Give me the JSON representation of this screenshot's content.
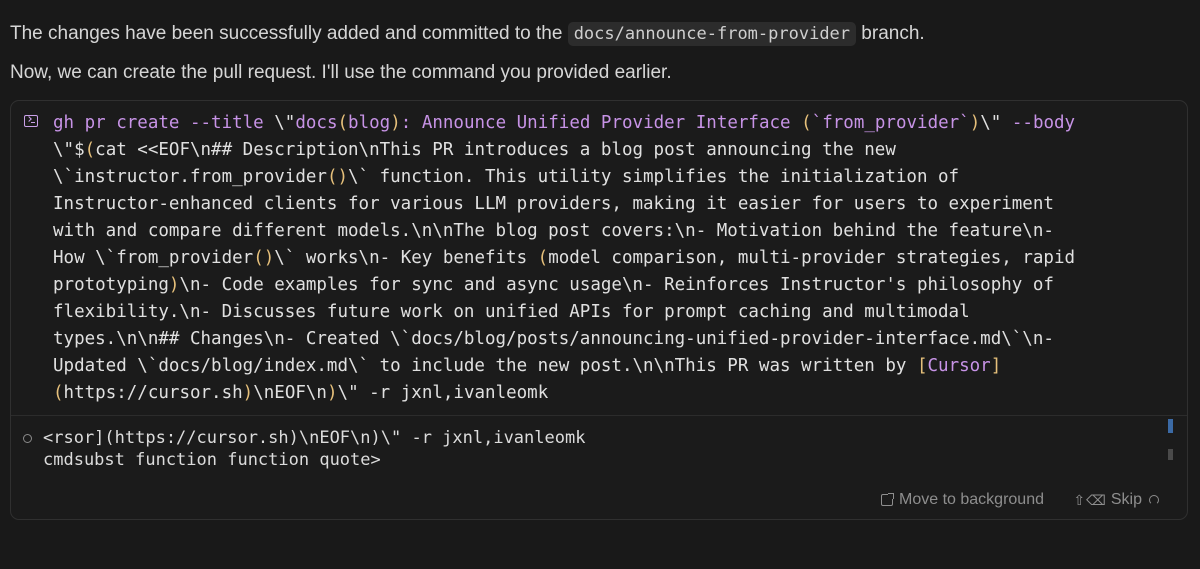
{
  "chat": {
    "line1_before": "The changes have been successfully added and committed to the ",
    "line1_code": "docs/announce-from-provider",
    "line1_after": " branch.",
    "line2": "Now, we can create the pull request. I'll use the command you provided earlier."
  },
  "command": {
    "lines": [
      [
        [
          "k",
          "gh pr create --title "
        ],
        [
          "o",
          "\\\""
        ],
        [
          "s",
          "docs"
        ],
        [
          "y",
          "("
        ],
        [
          "s",
          "blog"
        ],
        [
          "y",
          ")"
        ],
        [
          "s",
          ": Announce Unified Provider Interface "
        ],
        [
          "y",
          "("
        ],
        [
          "s",
          "`from_provider`"
        ],
        [
          "y",
          ")"
        ],
        [
          "o",
          "\\\""
        ],
        [
          "k",
          " --body"
        ]
      ],
      [
        [
          "o",
          "\\\"$"
        ],
        [
          "y",
          "("
        ],
        [
          "o",
          "cat <<EOF\\n## Description\\nThis PR introduces a blog post announcing the new"
        ]
      ],
      [
        [
          "o",
          "\\`instructor.from_provider"
        ],
        [
          "y",
          "()"
        ],
        [
          "o",
          "\\` function. This utility simplifies the initialization of"
        ]
      ],
      [
        [
          "o",
          "Instructor-enhanced clients for various LLM providers, making it easier for users to experiment"
        ]
      ],
      [
        [
          "o",
          "with and compare different models.\\n\\nThe blog post covers:\\n- Motivation behind the feature\\n-"
        ]
      ],
      [
        [
          "o",
          "How \\`from_provider"
        ],
        [
          "y",
          "()"
        ],
        [
          "o",
          "\\` works\\n- Key benefits "
        ],
        [
          "y",
          "("
        ],
        [
          "o",
          "model comparison, multi-provider strategies, rapid"
        ]
      ],
      [
        [
          "o",
          "prototyping"
        ],
        [
          "y",
          ")"
        ],
        [
          "o",
          "\\n- Code examples for sync and async usage\\n- Reinforces Instructor's philosophy of"
        ]
      ],
      [
        [
          "o",
          "flexibility.\\n- Discusses future work on unified APIs for prompt caching and multimodal"
        ]
      ],
      [
        [
          "o",
          "types.\\n\\n## Changes\\n- Created \\`docs/blog/posts/announcing-unified-provider-interface.md\\`\\n-"
        ]
      ],
      [
        [
          "o",
          "Updated \\`docs/blog/index.md\\` to include the new post.\\n\\nThis PR was written by "
        ],
        [
          "y",
          "["
        ],
        [
          "s",
          "Cursor"
        ],
        [
          "y",
          "]"
        ]
      ],
      [
        [
          "y",
          "("
        ],
        [
          "o",
          "https://cursor.sh"
        ],
        [
          "y",
          ")"
        ],
        [
          "o",
          "\\nEOF\\n"
        ],
        [
          "y",
          ")"
        ],
        [
          "o",
          "\\\" -r jxnl,ivanleomk"
        ]
      ]
    ]
  },
  "terminal_output": {
    "line1": "<rsor](https://cursor.sh)\\nEOF\\n)\\\" -r jxnl,ivanleomk",
    "line2": "cmdsubst function function quote>"
  },
  "actions": {
    "move_to_background": "Move to background",
    "skip": "Skip",
    "skip_shortcut": "⇧⌫"
  },
  "colors": {
    "background": "#191919",
    "keyword_purple": "#c793e6",
    "bracket_yellow": "#e6c07b"
  }
}
